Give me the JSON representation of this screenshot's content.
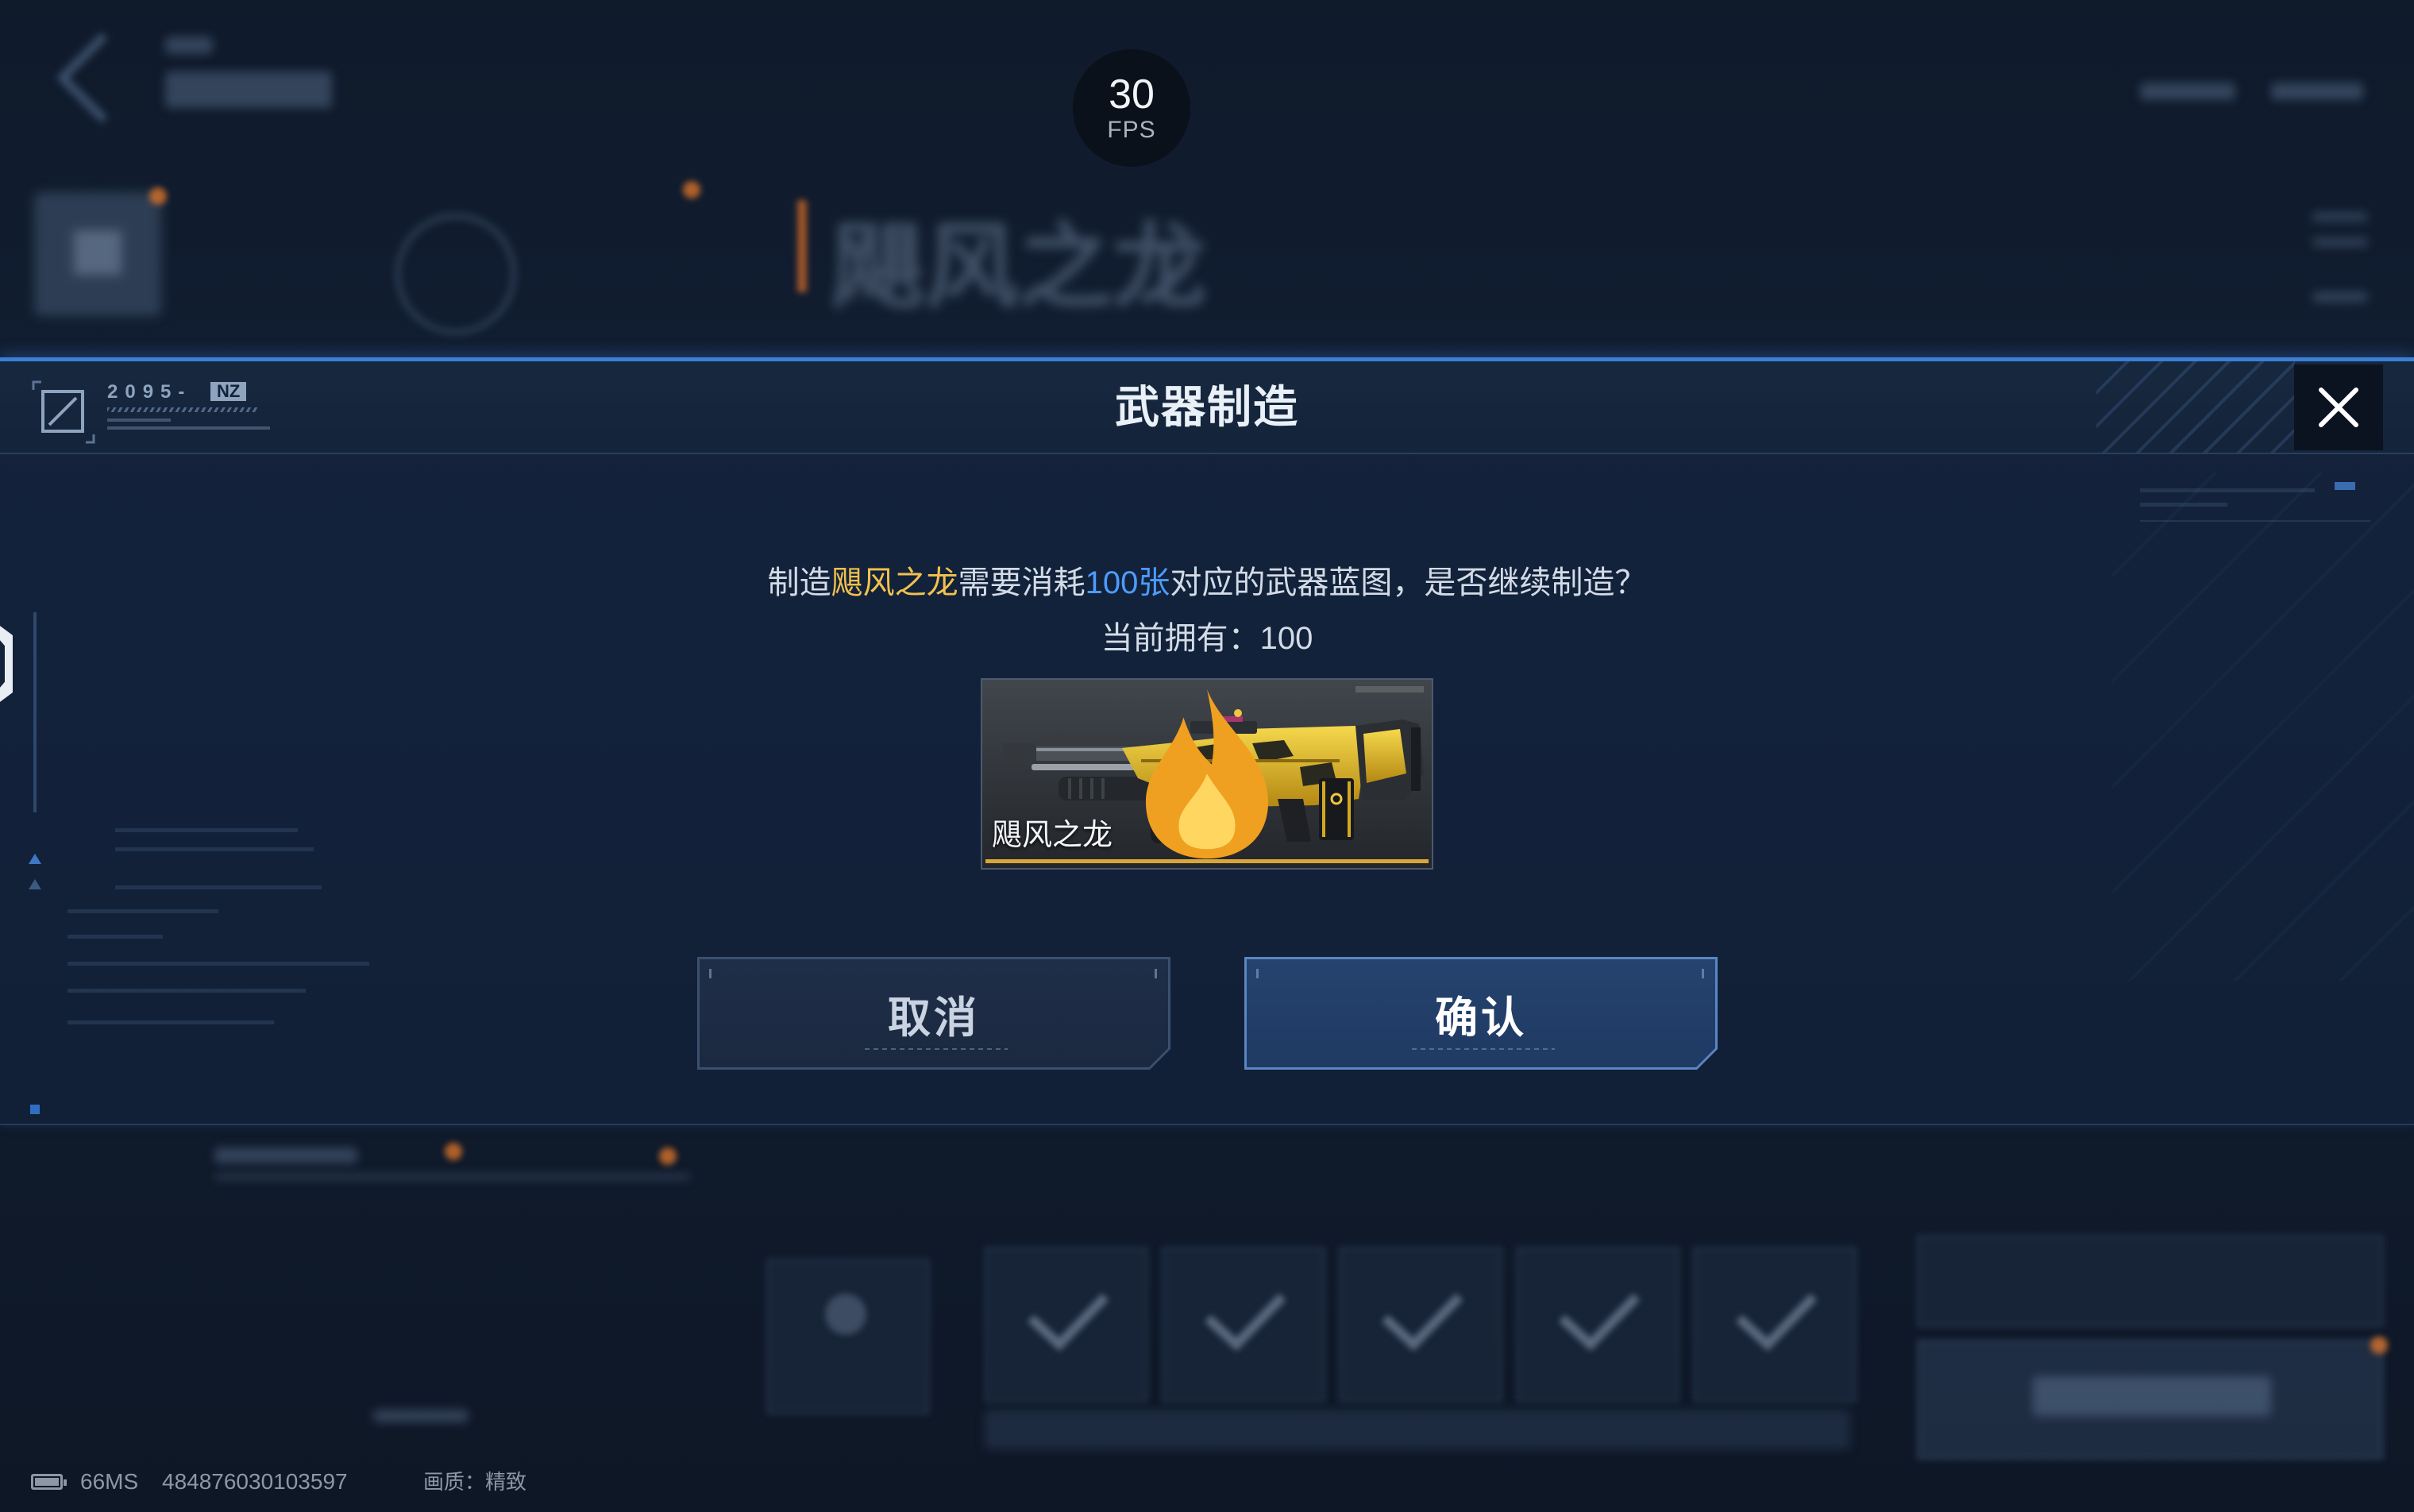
{
  "fps": {
    "value": "30",
    "label": "FPS"
  },
  "background": {
    "weapon_title": "飓风之龙"
  },
  "dialog": {
    "title": "武器制造",
    "brand": {
      "code": "2095-",
      "tag": "NZ"
    },
    "close_icon": "close-icon",
    "message": {
      "prefix": "制造",
      "weapon": "飓风之龙",
      "mid": "需要消耗",
      "cost": "100张",
      "suffix": "对应的武器蓝图，是否继续制造？"
    },
    "owned": {
      "label": "当前拥有：",
      "value": "100"
    },
    "card": {
      "name": "飓风之龙",
      "icon": "flame-icon",
      "image": "gold-heavy-machine-gun"
    },
    "buttons": {
      "cancel": "取消",
      "confirm": "确认"
    }
  },
  "status_bar": {
    "ping": "66MS",
    "id": "484876030103597",
    "quality_label": "画质：",
    "quality_value": "精致"
  },
  "colors": {
    "accent": "#3b7fd6",
    "weapon_highlight": "#f2c14e",
    "cost_highlight": "#4d9bff",
    "text": "#d3dbe6"
  }
}
